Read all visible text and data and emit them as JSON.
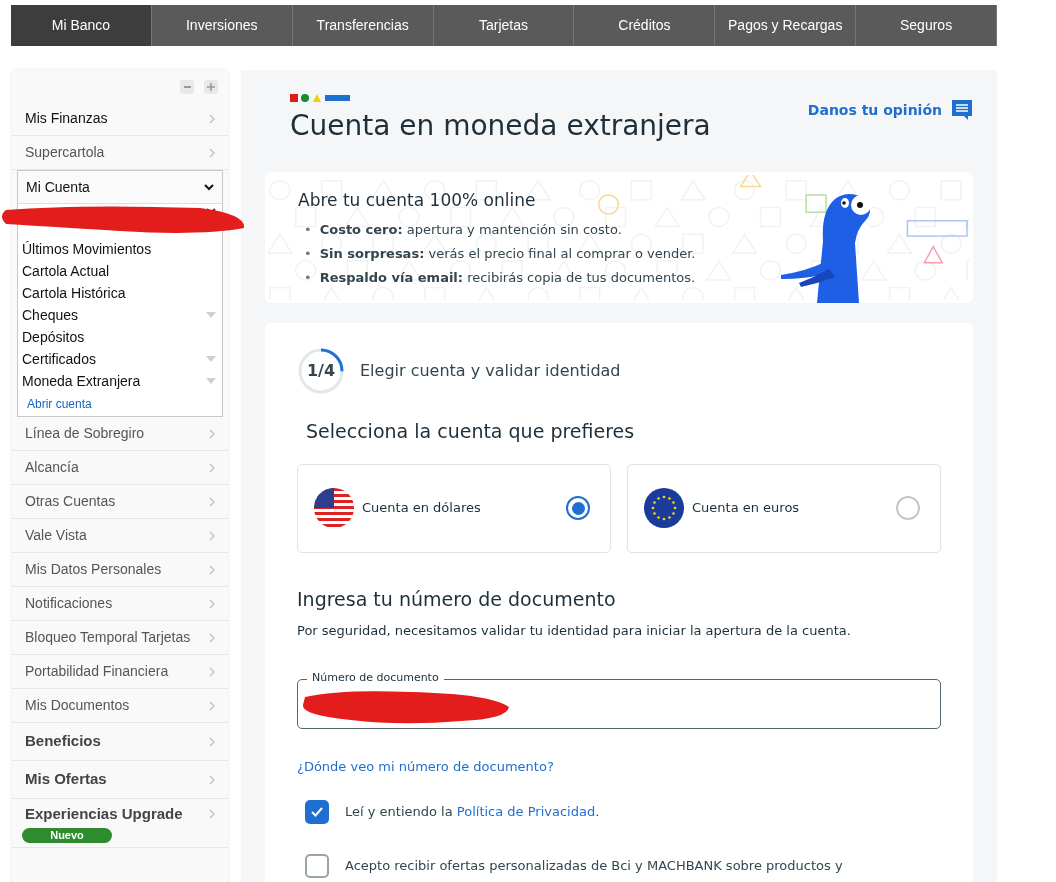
{
  "nav": {
    "tabs": [
      {
        "label": "Mi Banco",
        "selected": true
      },
      {
        "label": "Inversiones",
        "selected": false
      },
      {
        "label": "Transferencias",
        "selected": false
      },
      {
        "label": "Tarjetas",
        "selected": false
      },
      {
        "label": "Créditos",
        "selected": false
      },
      {
        "label": "Pagos y Recargas",
        "selected": false
      },
      {
        "label": "Seguros",
        "selected": false
      }
    ]
  },
  "sidebar": {
    "items": [
      {
        "kind": "primary",
        "label": "Mis Finanzas"
      },
      {
        "kind": "link",
        "label": "Supercartola"
      },
      {
        "kind": "group",
        "label": "Mi Cuenta",
        "expanded": true,
        "children": [
          {
            "label": "Últimos Movimientos",
            "expandable": false
          },
          {
            "label": "Cartola Actual",
            "expandable": false
          },
          {
            "label": "Cartola Histórica",
            "expandable": false
          },
          {
            "label": "Cheques",
            "expandable": true
          },
          {
            "label": "Depósitos",
            "expandable": false
          },
          {
            "label": "Certificados",
            "expandable": true
          },
          {
            "label": "Moneda Extranjera",
            "expandable": true,
            "children": [
              {
                "label": "Abrir cuenta"
              }
            ]
          }
        ]
      },
      {
        "kind": "link",
        "label": "Línea de Sobregiro"
      },
      {
        "kind": "link",
        "label": "Alcancía"
      },
      {
        "kind": "link",
        "label": "Otras Cuentas"
      },
      {
        "kind": "link",
        "label": "Vale Vista"
      },
      {
        "kind": "link",
        "label": "Mis Datos Personales"
      },
      {
        "kind": "link",
        "label": "Notificaciones"
      },
      {
        "kind": "link",
        "label": "Bloqueo Temporal Tarjetas"
      },
      {
        "kind": "link",
        "label": "Portabilidad Financiera"
      },
      {
        "kind": "link",
        "label": "Mis Documentos"
      },
      {
        "kind": "bold",
        "label": "Beneficios"
      },
      {
        "kind": "bold",
        "label": "Mis Ofertas"
      },
      {
        "kind": "bold",
        "label": "Experiencias Upgrade",
        "badge": "Nuevo"
      }
    ]
  },
  "page": {
    "title": "Cuenta en moneda extranjera",
    "feedback": "Danos tu opinión"
  },
  "promo": {
    "title": "Abre tu cuenta 100% online",
    "bullets": [
      {
        "marker": "•",
        "text": "**Costo cero:** apertura y mantención sin costo."
      },
      {
        "marker": "•",
        "text": "**Sin sorpresas:** verás el precio final al comprar o vender."
      },
      {
        "marker": "•",
        "text": "**Respaldo vía email:** recibirás copia de tus documentos."
      }
    ]
  },
  "step": {
    "label": "1/4",
    "level": 0.25,
    "title": "Elegir cuenta y validar identidad"
  },
  "accounts": {
    "heading": "Selecciona la cuenta que prefieres",
    "options": [
      {
        "label": "Cuenta en dólares",
        "kind": "usd",
        "selected": true
      },
      {
        "label": "Cuenta en euros",
        "kind": "eur",
        "selected": false
      }
    ]
  },
  "document": {
    "heading": "Ingresa tu número de documento",
    "description": "Por seguridad, necesitamos validar tu identidad para iniciar la apertura de la cuenta.",
    "field_label": "Número de documento",
    "help_link": "¿Dónde veo mi número de documento?"
  },
  "consents": [
    {
      "text": "Leí y entiendo la ",
      "link": "Política de Privacidad",
      "after": ".",
      "checked": true
    },
    {
      "text": "Acepto recibir ofertas personalizadas de Bci y MACHBANK sobre productos y",
      "checked": false
    }
  ]
}
